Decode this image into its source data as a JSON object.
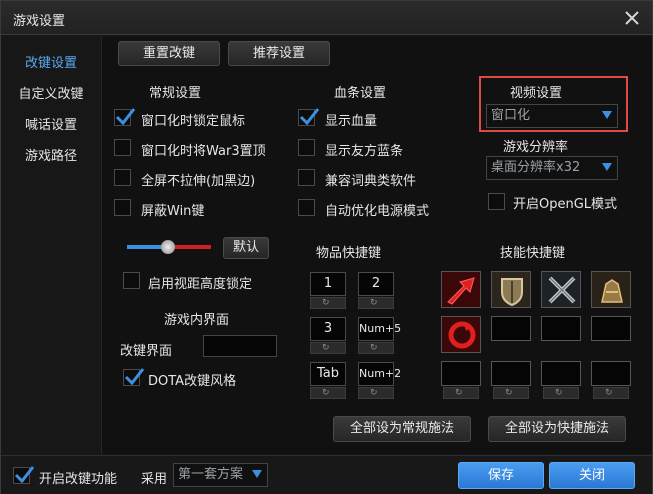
{
  "window": {
    "title": "游戏设置"
  },
  "sidebar": {
    "items": [
      {
        "label": "改键设置"
      },
      {
        "label": "自定义改键"
      },
      {
        "label": "喊话设置"
      },
      {
        "label": "游戏路径"
      }
    ]
  },
  "toolbar": {
    "reset_label": "重置改键",
    "recommend_label": "推荐设置"
  },
  "general": {
    "title": "常规设置",
    "options": [
      {
        "label": "窗口化时锁定鼠标",
        "checked": true
      },
      {
        "label": "窗口化时将War3置顶",
        "checked": false
      },
      {
        "label": "全屏不拉伸(加黑边)",
        "checked": false
      },
      {
        "label": "屏蔽Win键",
        "checked": false
      }
    ]
  },
  "health": {
    "title": "血条设置",
    "options": [
      {
        "label": "显示血量",
        "checked": true
      },
      {
        "label": "显示友方蓝条",
        "checked": false
      },
      {
        "label": "兼容词典类软件",
        "checked": false
      },
      {
        "label": "自动优化电源模式",
        "checked": false
      }
    ]
  },
  "video": {
    "title": "视频设置",
    "mode_value": "窗口化",
    "resolution_title": "游戏分辨率",
    "resolution_value": "桌面分辨率x32",
    "opengl_label": "开启OpenGL模式",
    "opengl_checked": false
  },
  "slider": {
    "default_label": "默认",
    "level": 0.35
  },
  "view_lock": {
    "label": "启用视距高度锁定",
    "checked": false
  },
  "game_ui": {
    "title": "游戏内界面",
    "remap_label": "改键界面",
    "remap_value": "",
    "dota_label": "DOTA改键风格",
    "dota_checked": true
  },
  "item_keys": {
    "title": "物品快捷键",
    "slots": [
      "1",
      "2",
      "3",
      "Num+5",
      "Tab",
      "Num+2"
    ]
  },
  "skill_keys": {
    "title": "技能快捷键"
  },
  "actions": {
    "normal_cast": "全部设为常规施法",
    "quick_cast": "全部设为快捷施法"
  },
  "footer": {
    "enable_label": "开启改键功能",
    "enable_checked": true,
    "use_label": "采用",
    "scheme_value": "第一套方案",
    "save_label": "保存",
    "close_label": "关闭"
  },
  "colors": {
    "accent": "#3d8fe0",
    "highlight_box": "#e04848",
    "active_sidebar": "#5aa8f0"
  }
}
